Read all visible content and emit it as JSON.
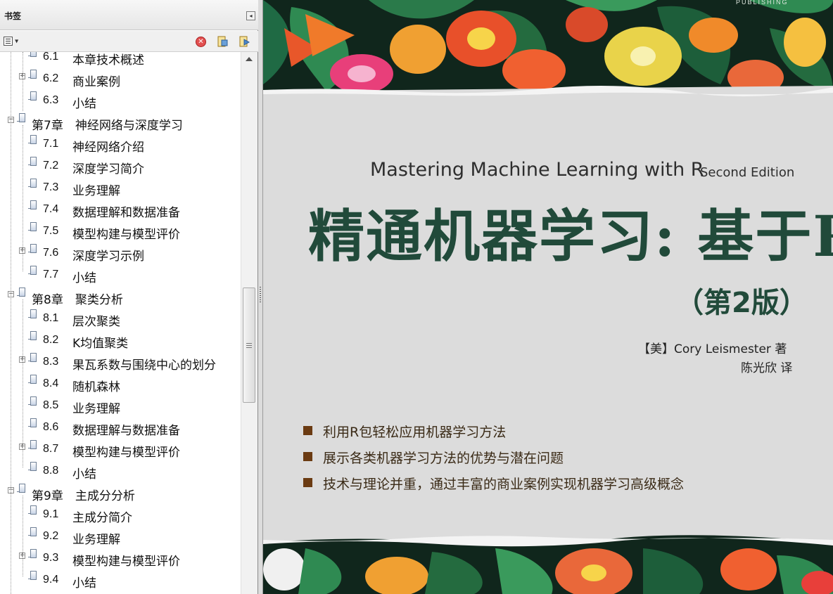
{
  "panel": {
    "title": "书签",
    "collapse_glyph": "◂",
    "delete_glyph": "✕"
  },
  "bookmarks": [
    {
      "num": "6.1",
      "title": "本章技术概述",
      "level": 2,
      "expandable": false
    },
    {
      "num": "6.2",
      "title": "商业案例",
      "level": 2,
      "expandable": true
    },
    {
      "num": "6.3",
      "title": "小结",
      "level": 2,
      "expandable": false
    },
    {
      "num": "",
      "title": "第7章　神经网络与深度学习",
      "level": 1,
      "expandable": true
    },
    {
      "num": "7.1",
      "title": "神经网络介绍",
      "level": 2,
      "expandable": false
    },
    {
      "num": "7.2",
      "title": "深度学习简介",
      "level": 2,
      "expandable": false
    },
    {
      "num": "7.3",
      "title": "业务理解",
      "level": 2,
      "expandable": false
    },
    {
      "num": "7.4",
      "title": "数据理解和数据准备",
      "level": 2,
      "expandable": false
    },
    {
      "num": "7.5",
      "title": "模型构建与模型评价",
      "level": 2,
      "expandable": false
    },
    {
      "num": "7.6",
      "title": "深度学习示例",
      "level": 2,
      "expandable": true
    },
    {
      "num": "7.7",
      "title": "小结",
      "level": 2,
      "expandable": false
    },
    {
      "num": "",
      "title": "第8章　聚类分析",
      "level": 1,
      "expandable": true
    },
    {
      "num": "8.1",
      "title": "层次聚类",
      "level": 2,
      "expandable": false
    },
    {
      "num": "8.2",
      "title": "K均值聚类",
      "level": 2,
      "expandable": false
    },
    {
      "num": "8.3",
      "title": "果瓦系数与围绕中心的划分",
      "level": 2,
      "expandable": true
    },
    {
      "num": "8.4",
      "title": "随机森林",
      "level": 2,
      "expandable": false
    },
    {
      "num": "8.5",
      "title": "业务理解",
      "level": 2,
      "expandable": false
    },
    {
      "num": "8.6",
      "title": "数据理解与数据准备",
      "level": 2,
      "expandable": false
    },
    {
      "num": "8.7",
      "title": "模型构建与模型评价",
      "level": 2,
      "expandable": true
    },
    {
      "num": "8.8",
      "title": "小结",
      "level": 2,
      "expandable": false
    },
    {
      "num": "",
      "title": "第9章　主成分分析",
      "level": 1,
      "expandable": true
    },
    {
      "num": "9.1",
      "title": "主成分简介",
      "level": 2,
      "expandable": false
    },
    {
      "num": "9.2",
      "title": "业务理解",
      "level": 2,
      "expandable": false
    },
    {
      "num": "9.3",
      "title": "模型构建与模型评价",
      "level": 2,
      "expandable": true
    },
    {
      "num": "9.4",
      "title": "小结",
      "level": 2,
      "expandable": false
    }
  ],
  "cover": {
    "publisher": "PUBLISHING",
    "en_title": "Mastering Machine Learning with R",
    "edition": "Second Edition",
    "cn_title": "精通机器学习: 基于R",
    "cn_subtitle": "（第2版）",
    "author": "【美】Cory Leismester  著",
    "translator": "陈光欣  译",
    "features": [
      "利用R包轻松应用机器学习方法",
      "展示各类机器学习方法的优势与潜在问题",
      "技术与理论并重，通过丰富的商业案例实现机器学习高级概念"
    ],
    "colors": {
      "title_green": "#214a3a",
      "bullet_brown": "#6b3b12",
      "page_bg": "#dcdcdc"
    }
  }
}
